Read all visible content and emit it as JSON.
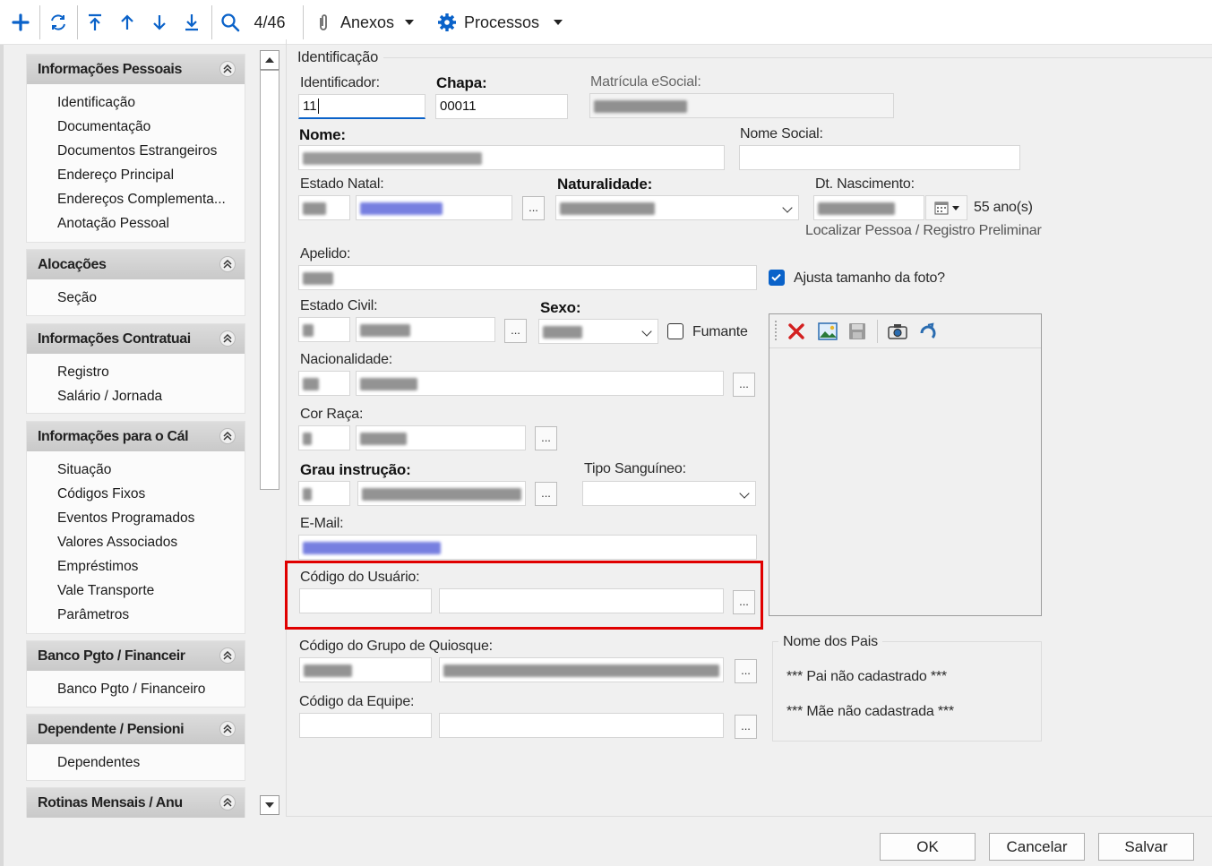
{
  "toolbar": {
    "counter": "4/46",
    "anexos_label": "Anexos",
    "processos_label": "Processos"
  },
  "nav": [
    {
      "title": "Informações Pessoais",
      "items": [
        "Identificação",
        "Documentação",
        "Documentos Estrangeiros",
        "Endereço Principal",
        "Endereços Complementa...",
        "Anotação Pessoal"
      ]
    },
    {
      "title": "Alocações",
      "items": [
        "Seção"
      ]
    },
    {
      "title": "Informações Contratuai",
      "items": [
        "Registro",
        "Salário / Jornada"
      ]
    },
    {
      "title": "Informações para o Cál",
      "items": [
        "Situação",
        "Códigos Fixos",
        "Eventos Programados",
        "Valores Associados",
        "Empréstimos",
        "Vale Transporte",
        "Parâmetros"
      ]
    },
    {
      "title": "Banco Pgto / Financeir",
      "items": [
        "Banco Pgto / Financeiro"
      ]
    },
    {
      "title": "Dependente / Pensioni",
      "items": [
        "Dependentes"
      ]
    },
    {
      "title": "Rotinas Mensais / Anu",
      "items": []
    }
  ],
  "form": {
    "group_title": "Identificação",
    "identificador_label": "Identificador:",
    "identificador_value": "11",
    "chapa_label": "Chapa:",
    "chapa_value": "00011",
    "matricula_label": "Matrícula eSocial:",
    "nome_label": "Nome:",
    "nome_social_label": "Nome Social:",
    "estado_natal_label": "Estado Natal:",
    "naturalidade_label": "Naturalidade:",
    "dt_nascimento_label": "Dt. Nascimento:",
    "idade_text": "55 ano(s)",
    "localizar_text": "Localizar Pessoa / Registro Preliminar",
    "apelido_label": "Apelido:",
    "ajusta_foto_label": "Ajusta tamanho da foto?",
    "estado_civil_label": "Estado Civil:",
    "sexo_label": "Sexo:",
    "fumante_label": "Fumante",
    "nacionalidade_label": "Nacionalidade:",
    "cor_raca_label": "Cor Raça:",
    "grau_instrucao_label": "Grau instrução:",
    "tipo_sanguineo_label": "Tipo Sanguíneo:",
    "email_label": "E-Mail:",
    "codigo_usuario_label": "Código do Usuário:",
    "codigo_quiosque_label": "Código do Grupo de Quiosque:",
    "codigo_equipe_label": "Código da Equipe:",
    "ellipsis": "...",
    "nome_pais_title": "Nome dos Pais",
    "pai_text": "*** Pai não cadastrado ***",
    "mae_text": "*** Mãe não cadastrada ***"
  },
  "buttons": {
    "ok": "OK",
    "cancelar": "Cancelar",
    "salvar": "Salvar"
  },
  "colors": {
    "accent": "#0a62c9",
    "highlight": "#e00000",
    "delete": "#d32020"
  }
}
